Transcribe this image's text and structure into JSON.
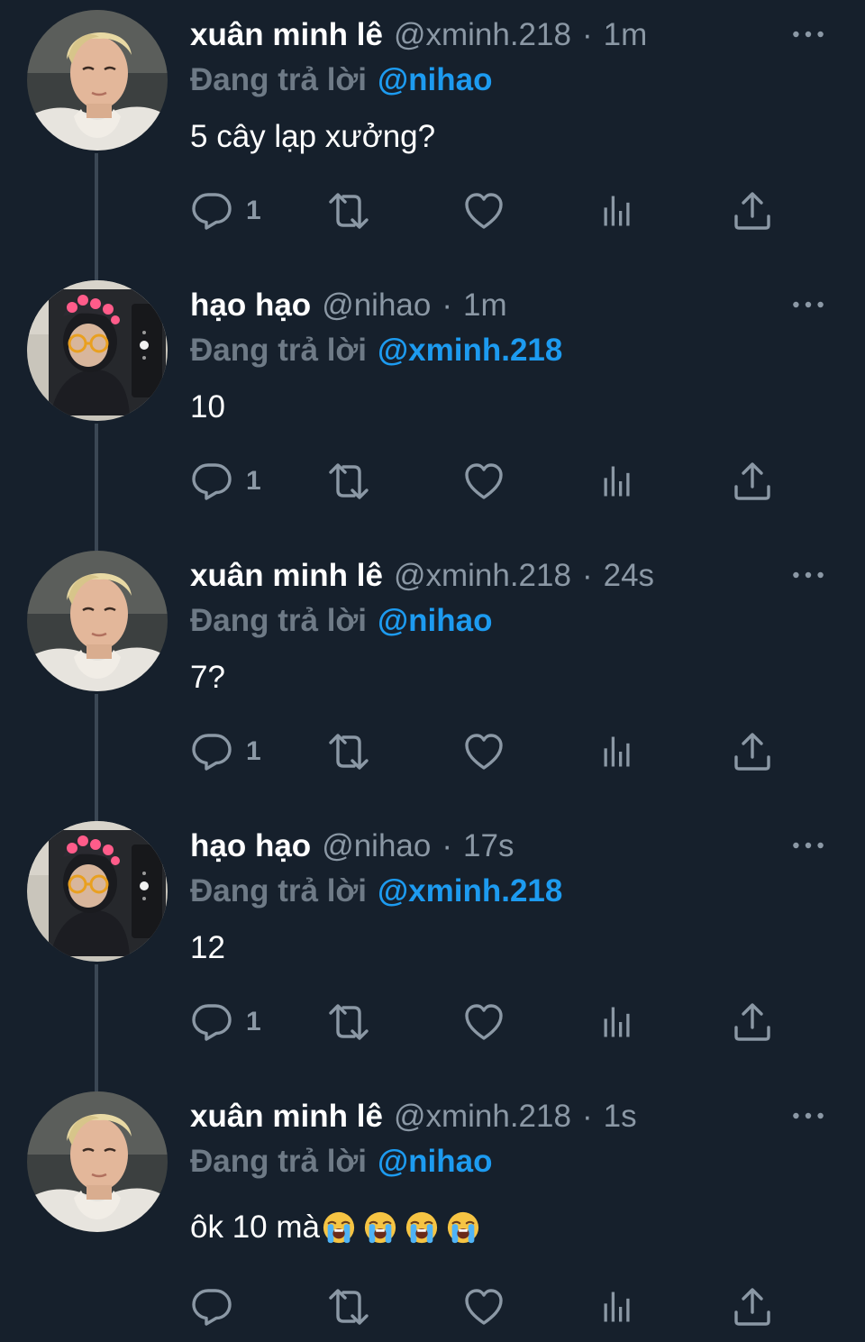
{
  "icons": {
    "reply": "speech-bubble-icon",
    "retweet": "retweet-arrows-icon",
    "like": "heart-icon",
    "views": "bar-chart-icon",
    "share": "upload-icon",
    "more": "ellipsis-icon",
    "emoji": "loudly-crying-face-emoji"
  },
  "colors": {
    "background": "#16202c",
    "muted": "#8b98a5",
    "reply_prefix": "#6e7a86",
    "accent": "#1d9bf0",
    "thread_line": "#3b4754"
  },
  "tweets": [
    {
      "author": "xuân minh lê",
      "handle": "@xminh.218",
      "separator": "·",
      "time": "1m",
      "reply_prefix": "Đang trả lời",
      "reply_to": "@nihao",
      "text": "5 cây lạp xưởng?",
      "reply_count": "1"
    },
    {
      "author": "hạo hạo",
      "handle": "@nihao",
      "separator": "·",
      "time": "1m",
      "reply_prefix": "Đang trả lời",
      "reply_to": "@xminh.218",
      "text": "10",
      "reply_count": "1"
    },
    {
      "author": "xuân minh lê",
      "handle": "@xminh.218",
      "separator": "·",
      "time": "24s",
      "reply_prefix": "Đang trả lời",
      "reply_to": "@nihao",
      "text": "7?",
      "reply_count": "1"
    },
    {
      "author": "hạo hạo",
      "handle": "@nihao",
      "separator": "·",
      "time": "17s",
      "reply_prefix": "Đang trả lời",
      "reply_to": "@xminh.218",
      "text": "12",
      "reply_count": "1"
    },
    {
      "author": "xuân minh lê",
      "handle": "@xminh.218",
      "separator": "·",
      "time": "1s",
      "reply_prefix": "Đang trả lời",
      "reply_to": "@nihao",
      "text": "ôk 10 mà",
      "emoji_count": 4,
      "reply_count": ""
    }
  ]
}
